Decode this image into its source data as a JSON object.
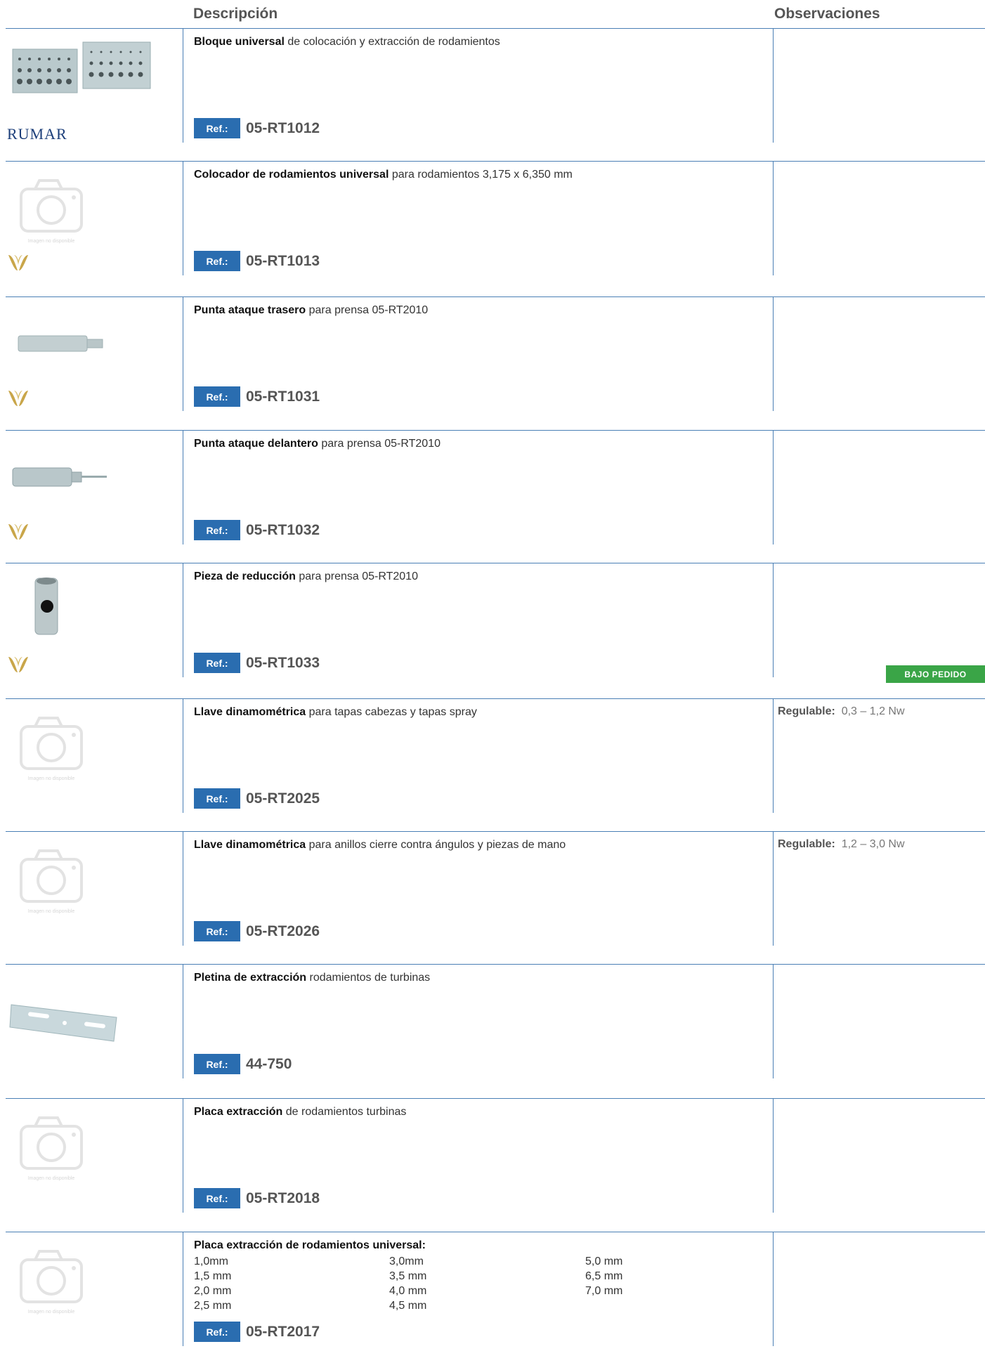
{
  "header": {
    "descripcion": "Descripción",
    "observaciones": "Observaciones"
  },
  "ref_label": "Ref.:",
  "rumar_logo": "RUMAR",
  "placeholder_text": "Imagen no disponible",
  "rows": [
    {
      "title": "Bloque universal",
      "rest": " de colocación y extracción de rodamientos",
      "ref": "05-RT1012",
      "obs_label": "",
      "obs_value": "",
      "badge": "",
      "image": "bearing-block",
      "logo": "rumar"
    },
    {
      "title": "Colocador de rodamientos universal",
      "rest": " para rodamientos 3,175 x 6,350 mm",
      "ref": "05-RT1013",
      "obs_label": "",
      "obs_value": "",
      "badge": "",
      "image": "placeholder",
      "logo": "v"
    },
    {
      "title": "Punta ataque trasero",
      "rest": " para prensa 05-RT2010",
      "ref": "05-RT1031",
      "obs_label": "",
      "obs_value": "",
      "badge": "",
      "image": "punch-rear",
      "logo": "v"
    },
    {
      "title": "Punta ataque delantero",
      "rest": " para prensa 05-RT2010",
      "ref": "05-RT1032",
      "obs_label": "",
      "obs_value": "",
      "badge": "",
      "image": "punch-front",
      "logo": "v"
    },
    {
      "title": "Pieza de reducción",
      "rest": " para prensa 05-RT2010",
      "ref": "05-RT1033",
      "obs_label": "",
      "obs_value": "",
      "badge": "BAJO PEDIDO",
      "image": "reducer",
      "logo": "v"
    },
    {
      "title": "Llave dinamométrica",
      "rest": " para tapas cabezas y tapas spray",
      "ref": "05-RT2025",
      "obs_label": "Regulable:",
      "obs_value": "0,3 – 1,2 Nw",
      "badge": "",
      "image": "placeholder",
      "logo": ""
    },
    {
      "title": "Llave dinamométrica",
      "rest": " para anillos cierre contra ángulos y piezas de mano",
      "ref": "05-RT2026",
      "obs_label": "Regulable:",
      "obs_value": "1,2 – 3,0 Nw",
      "badge": "",
      "image": "placeholder",
      "logo": ""
    },
    {
      "title": "Pletina de extracción",
      "rest": " rodamientos de turbinas",
      "ref": "44-750",
      "obs_label": "",
      "obs_value": "",
      "badge": "",
      "image": "plate",
      "logo": ""
    },
    {
      "title": "Placa extracción",
      "rest": " de rodamientos turbinas",
      "ref": "05-RT2018",
      "obs_label": "",
      "obs_value": "",
      "badge": "",
      "image": "placeholder",
      "logo": ""
    },
    {
      "title": "Placa extracción de rodamientos universal:",
      "rest": "",
      "ref": "05-RT2017",
      "obs_label": "",
      "obs_value": "",
      "badge": "",
      "image": "placeholder",
      "logo": "",
      "sizes": [
        [
          "1,0mm",
          "1,5 mm",
          "2,0 mm",
          "2,5 mm"
        ],
        [
          "3,0mm",
          "3,5 mm",
          "4,0 mm",
          "4,5 mm"
        ],
        [
          "5,0 mm",
          "6,5 mm",
          "7,0 mm"
        ]
      ]
    }
  ]
}
